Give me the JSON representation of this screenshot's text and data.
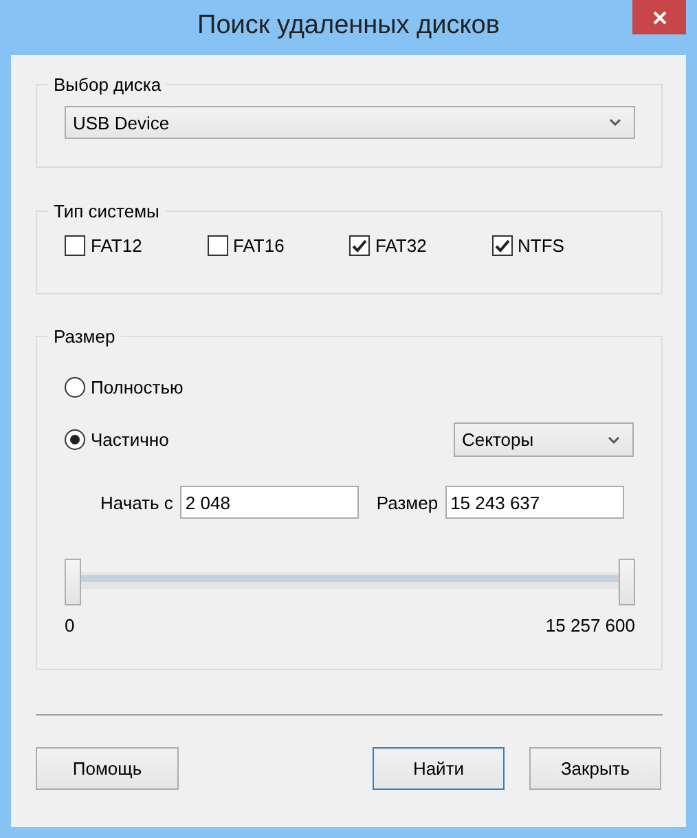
{
  "window": {
    "title": "Поиск удаленных дисков"
  },
  "disk_group": {
    "label": "Выбор диска",
    "dropdown": {
      "value": "USB Device"
    }
  },
  "fs_group": {
    "label": "Тип системы",
    "options": [
      {
        "label": "FAT12",
        "checked": false
      },
      {
        "label": "FAT16",
        "checked": false
      },
      {
        "label": "FAT32",
        "checked": true
      },
      {
        "label": "NTFS",
        "checked": true
      }
    ]
  },
  "size_group": {
    "label": "Размер",
    "modes": [
      {
        "label": "Полностью",
        "selected": false
      },
      {
        "label": "Частично",
        "selected": true
      }
    ],
    "unit_dropdown": {
      "value": "Секторы"
    },
    "start_field": {
      "label": "Начать с",
      "value": "2 048"
    },
    "size_field": {
      "label": "Размер",
      "value": "15 243 637"
    },
    "slider": {
      "thumbs": [
        {
          "level": 0
        },
        {
          "level": 1
        }
      ],
      "min_label": "0",
      "max_label": "15 257 600"
    }
  },
  "buttons": [
    {
      "label": "Помощь",
      "default": false
    },
    {
      "label": "Найти",
      "default": true
    },
    {
      "label": "Закрыть",
      "default": false
    }
  ]
}
